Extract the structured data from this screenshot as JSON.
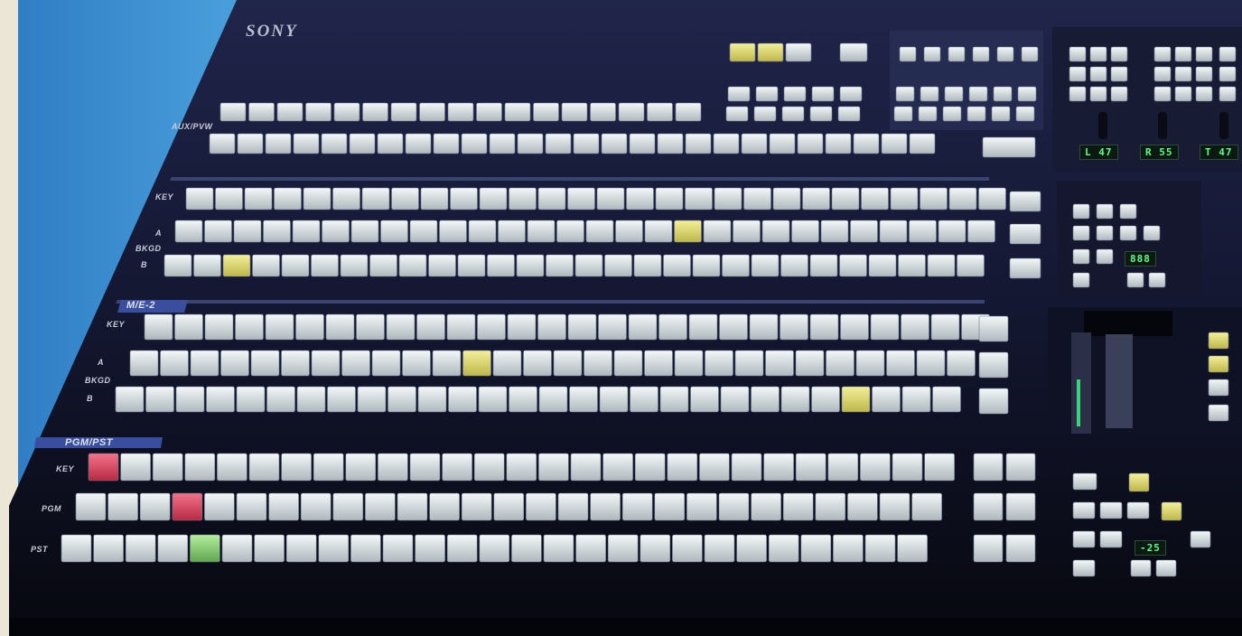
{
  "panel": {
    "brand": "SONY",
    "rows": {
      "aux_pvw": "AUX/PVW",
      "me1_key": "KEY",
      "me1_a": "A",
      "me1_bkgd": "BKGD",
      "me1_b": "B",
      "me2_key": "KEY",
      "me2_a": "A",
      "me2_bkgd": "BKGD",
      "me2_b": "B",
      "pgm_key": "KEY",
      "pgm": "PGM",
      "pst": "PST"
    },
    "sections": {
      "me2": "M/E-2",
      "pgm_pst": "PGM/PST"
    },
    "displays": {
      "fader_l": "L 47",
      "fader_r": "R 55",
      "fader_t": "T 47",
      "me1_counter": "888",
      "pgm_counter": "-25"
    }
  },
  "colors": {
    "panel_top": "#1b1f3a",
    "panel_bottom": "#090b18",
    "button_face": "#dfe6e8",
    "lit_yellow": "#e4df6a",
    "lit_red": "#e0405a",
    "lit_green": "#8fd67c",
    "backdrop_blue": "#3f8fd0"
  }
}
